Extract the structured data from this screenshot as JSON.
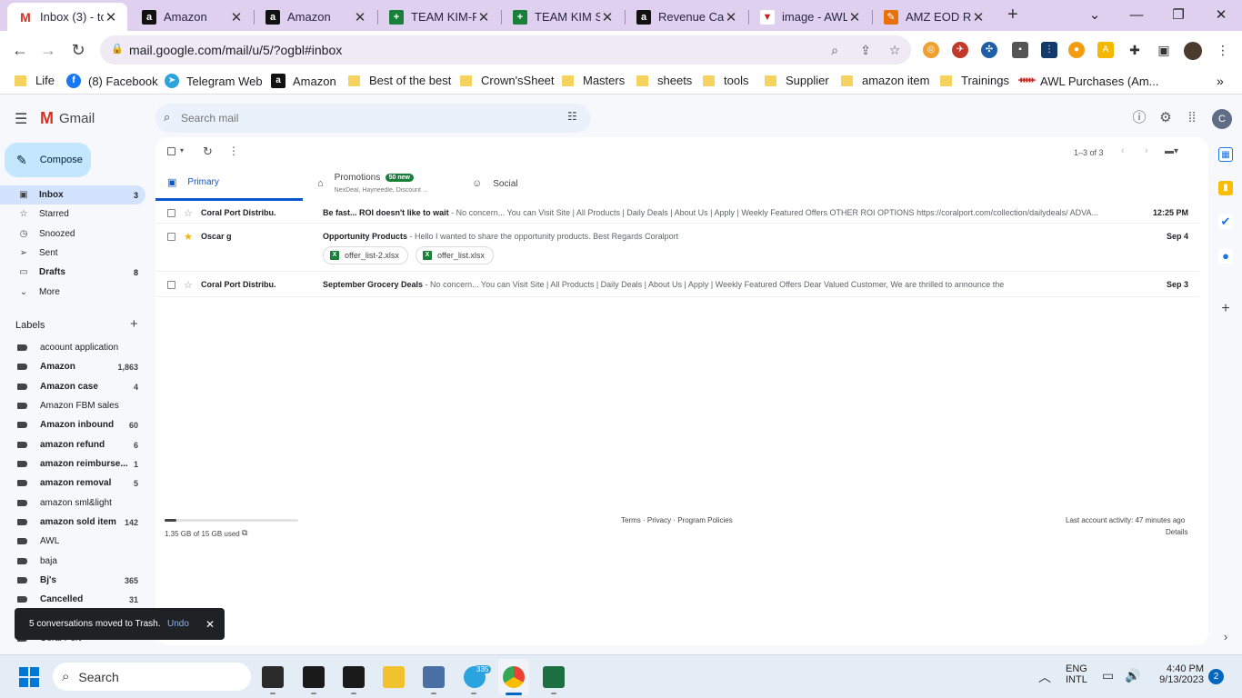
{
  "tabs": [
    {
      "title": "Inbox (3) - tc",
      "icon": "gmail-icon",
      "active": true
    },
    {
      "title": "Amazon",
      "icon": "amazon-icon"
    },
    {
      "title": "Amazon",
      "icon": "amazon-icon"
    },
    {
      "title": "TEAM KIM-RE",
      "icon": "sheets-icon"
    },
    {
      "title": "TEAM KIM SA",
      "icon": "sheets-icon"
    },
    {
      "title": "Revenue Calc",
      "icon": "amazon-icon"
    },
    {
      "title": "image - AWL",
      "icon": "awl-icon"
    },
    {
      "title": "AMZ EOD Rep",
      "icon": "app-icon"
    }
  ],
  "browser": {
    "url": "mail.google.com/mail/u/5/?ogbl#inbox",
    "new_tab": "+"
  },
  "bookmarks": [
    {
      "label": "Life",
      "type": "folder"
    },
    {
      "label": "(8) Facebook",
      "type": "facebook"
    },
    {
      "label": "Telegram Web",
      "type": "telegram"
    },
    {
      "label": "Amazon",
      "type": "amazon"
    },
    {
      "label": "Best of the best",
      "type": "folder"
    },
    {
      "label": "Crown'sSheet",
      "type": "folder"
    },
    {
      "label": "Masters",
      "type": "folder"
    },
    {
      "label": "sheets",
      "type": "folder"
    },
    {
      "label": "tools",
      "type": "folder"
    },
    {
      "label": "Supplier",
      "type": "folder"
    },
    {
      "label": "amazon item",
      "type": "folder"
    },
    {
      "label": "Trainings",
      "type": "folder"
    },
    {
      "label": "AWL Purchases (Am...",
      "type": "awl"
    }
  ],
  "gmail": {
    "logo_text": "Gmail",
    "search_placeholder": "Search mail",
    "avatar_letter": "C",
    "compose": "Compose",
    "nav": [
      {
        "label": "Inbox",
        "count": "3",
        "icon": "inbox-icon",
        "selected": true
      },
      {
        "label": "Starred",
        "count": "",
        "icon": "star-icon"
      },
      {
        "label": "Snoozed",
        "count": "",
        "icon": "clock-icon"
      },
      {
        "label": "Sent",
        "count": "",
        "icon": "send-icon"
      },
      {
        "label": "Drafts",
        "count": "8",
        "icon": "draft-icon"
      },
      {
        "label": "More",
        "count": "",
        "icon": "chevron-down-icon"
      }
    ],
    "labels_title": "Labels",
    "labels": [
      {
        "label": "acoount application",
        "count": "",
        "bold": false
      },
      {
        "label": "Amazon",
        "count": "1,863",
        "bold": true
      },
      {
        "label": "Amazon case",
        "count": "4",
        "bold": true
      },
      {
        "label": "Amazon FBM sales",
        "count": "",
        "bold": false
      },
      {
        "label": "Amazon inbound",
        "count": "60",
        "bold": true
      },
      {
        "label": "amazon refund",
        "count": "6",
        "bold": true
      },
      {
        "label": "amazon reimburse...",
        "count": "1",
        "bold": true
      },
      {
        "label": "amazon removal",
        "count": "5",
        "bold": true
      },
      {
        "label": "amazon sml&light",
        "count": "",
        "bold": false
      },
      {
        "label": "amazon sold item",
        "count": "142",
        "bold": true
      },
      {
        "label": "AWL",
        "count": "",
        "bold": false
      },
      {
        "label": "baja",
        "count": "",
        "bold": false
      },
      {
        "label": "Bj's",
        "count": "365",
        "bold": true
      },
      {
        "label": "Cancelled",
        "count": "31",
        "bold": true
      },
      {
        "label": "Coral Port",
        "count": "",
        "bold": false
      }
    ],
    "pagination": "1–3 of 3",
    "tabs": {
      "primary": "Primary",
      "promotions": "Promotions",
      "promotions_badge": "50 new",
      "promotions_sub": "NexDeal, Hayneedle, Discount ...",
      "social": "Social"
    },
    "emails": [
      {
        "from": "Coral Port Distribu.",
        "subject": "Be fast... ROI doesn't like to wait",
        "snippet": " - No concern... You can Visit Site | All Products | Daily Deals | About Us | Apply | Weekly Featured Offers OTHER ROI OPTIONS https://coralport.com/collection/dailydeals/ ADVA...",
        "date": "12:25 PM",
        "starred": false
      },
      {
        "from": "Oscar g",
        "subject": "Opportunity Products",
        "snippet": " - Hello I wanted to share the opportunity products. Best Regards Coralport",
        "date": "Sep 4",
        "starred": true,
        "attachments": [
          "offer_list-2.xlsx",
          "offer_list.xlsx"
        ]
      },
      {
        "from": "Coral Port Distribu.",
        "subject": "September Grocery Deals",
        "snippet": " - No concern... You can Visit Site | All Products | Daily Deals | About Us | Apply | Weekly Featured Offers Dear Valued Customer, We are thrilled to announce the",
        "date": "Sep 3",
        "starred": false
      }
    ],
    "storage": "1.35 GB of 15 GB used",
    "storage_fraction": 0.09,
    "footer_links": "Terms · Privacy · Program Policies",
    "last_activity": "Last account activity: 47 minutes ago",
    "details": "Details",
    "toast": {
      "message": "5 conversations moved to Trash.",
      "undo": "Undo"
    }
  },
  "taskbar": {
    "search": "Search",
    "telegram_badge": "335",
    "lang1": "ENG",
    "lang2": "INTL",
    "time": "4:40 PM",
    "date": "9/13/2023",
    "notifications": "2"
  },
  "colors": {
    "tabstrip": "#dfd0f0",
    "selected_nav": "#d3e3fd",
    "compose": "#c2e7ff",
    "gmail_red": "#d93025",
    "sheets_green": "#188038"
  }
}
